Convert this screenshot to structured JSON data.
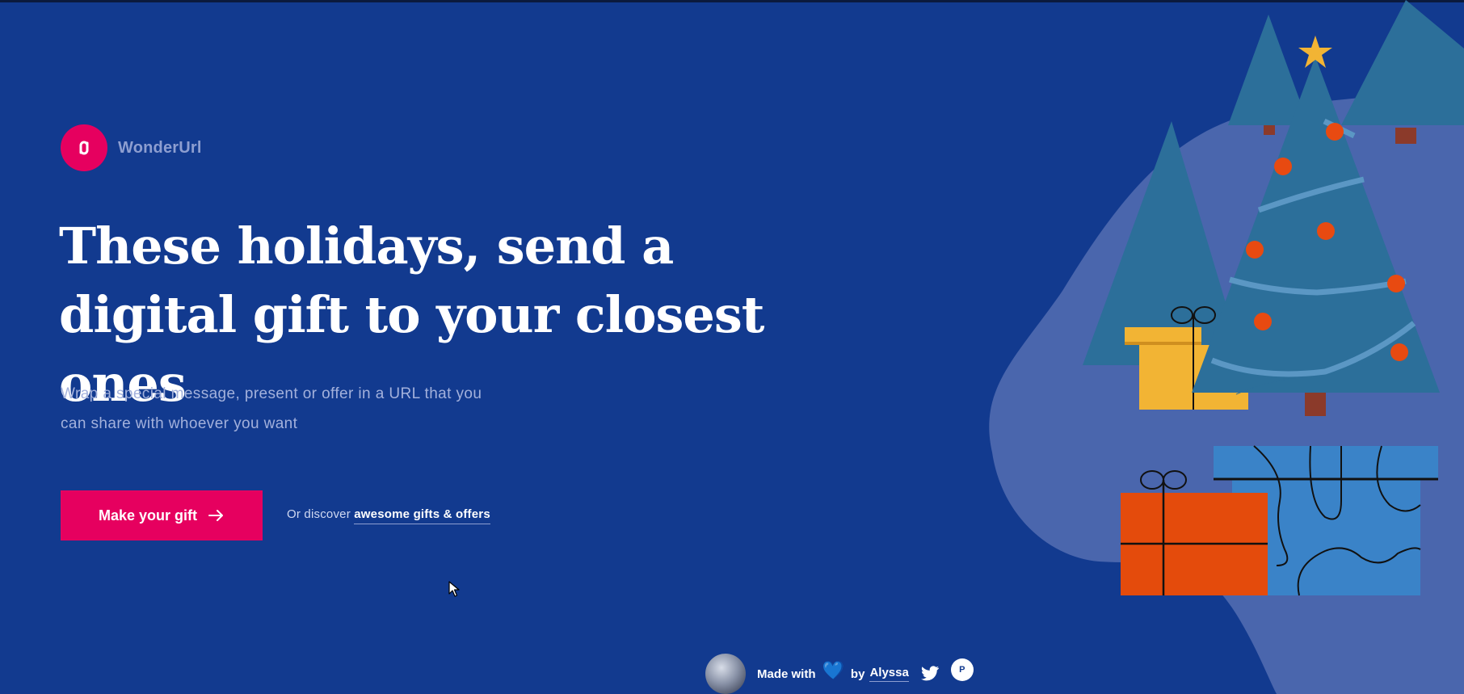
{
  "brand": {
    "name": "WonderUrl",
    "logo_icon": "link-icon",
    "accent_color": "#e6005f",
    "background_color": "#123a8f"
  },
  "hero": {
    "headline": "These holidays, send a digital gift to your closest ones",
    "subhead": "Wrap a special message, present or offer in a URL that you can share with whoever you want",
    "cta_label": "Make your gift",
    "cta_icon": "arrow-right-icon",
    "discover_prefix": "Or discover",
    "discover_link": "awesome gifts & offers"
  },
  "footer": {
    "made_with": "Made with",
    "heart_icon": "blue-heart-icon",
    "by": "by",
    "author": "Alyssa",
    "twitter_icon": "twitter-icon",
    "badge_icon": "product-hunt-icon",
    "badge_letter": "P"
  }
}
